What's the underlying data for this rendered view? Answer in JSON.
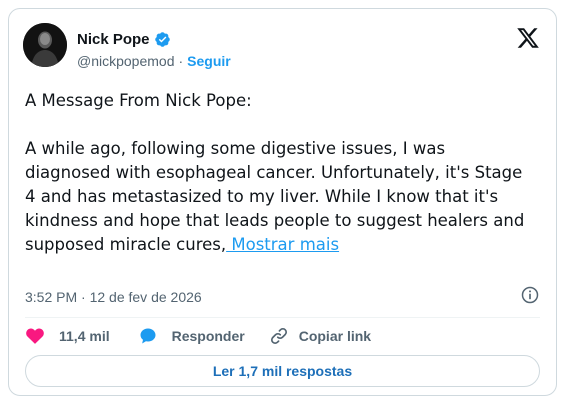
{
  "author": {
    "name": "Nick Pope",
    "handle": "@nickpopemod",
    "separator": "·",
    "follow_label": "Seguir",
    "verified": true
  },
  "tweet": {
    "heading": "A Message From Nick Pope:",
    "body": "A while ago, following some digestive issues, I was diagnosed with esophageal cancer. Unfortunately, it's Stage 4 and has metastasized to my liver. While I know that it's kindness and hope that leads people to suggest healers and supposed miracle cures,",
    "show_more": " Mostrar mais",
    "timestamp": "3:52 PM · 12 de fev de 2026"
  },
  "actions": {
    "like_count": "11,4 mil",
    "reply_label": "Responder",
    "copy_link_label": "Copiar link"
  },
  "replies_button": "Ler 1,7 mil respostas",
  "colors": {
    "accent": "#1d9bf0",
    "like": "#f91880",
    "text": "#0f1419",
    "muted": "#536471"
  },
  "icons": [
    "verified-badge-icon",
    "x-logo-icon",
    "info-icon",
    "heart-icon",
    "reply-bubble-icon",
    "link-icon"
  ]
}
